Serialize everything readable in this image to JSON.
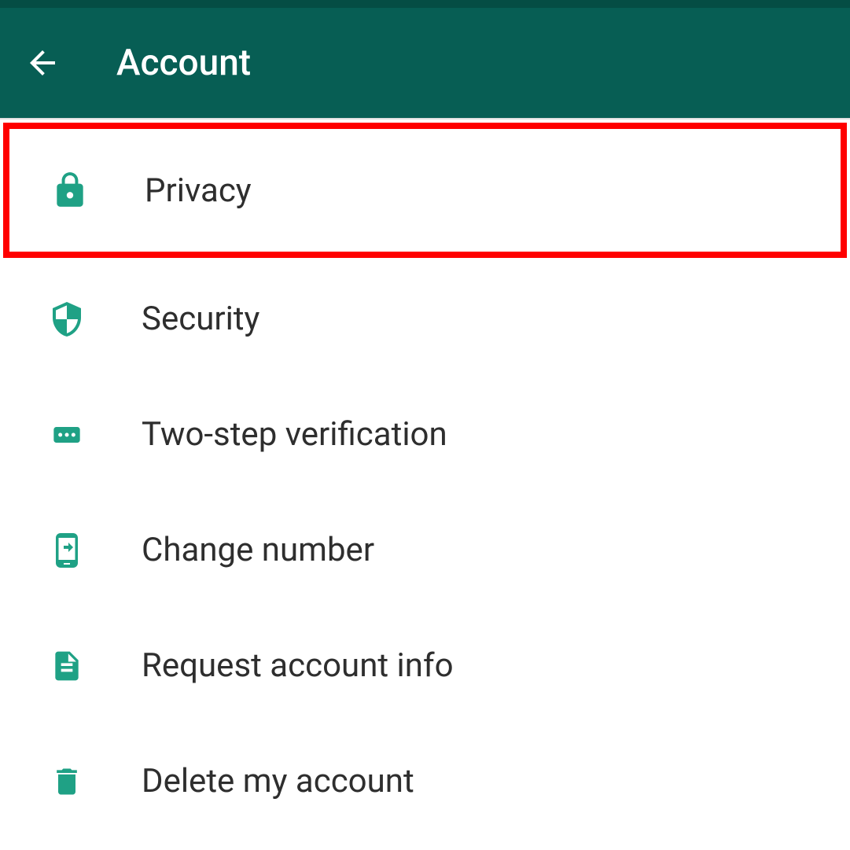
{
  "header": {
    "title": "Account"
  },
  "menu": {
    "items": [
      {
        "label": "Privacy",
        "highlighted": true
      },
      {
        "label": "Security",
        "highlighted": false
      },
      {
        "label": "Two-step verification",
        "highlighted": false
      },
      {
        "label": "Change number",
        "highlighted": false
      },
      {
        "label": "Request account info",
        "highlighted": false
      },
      {
        "label": "Delete my account",
        "highlighted": false
      }
    ]
  },
  "colors": {
    "primary": "#075e54",
    "accent": "#1fa185",
    "highlight": "#ff0000"
  }
}
